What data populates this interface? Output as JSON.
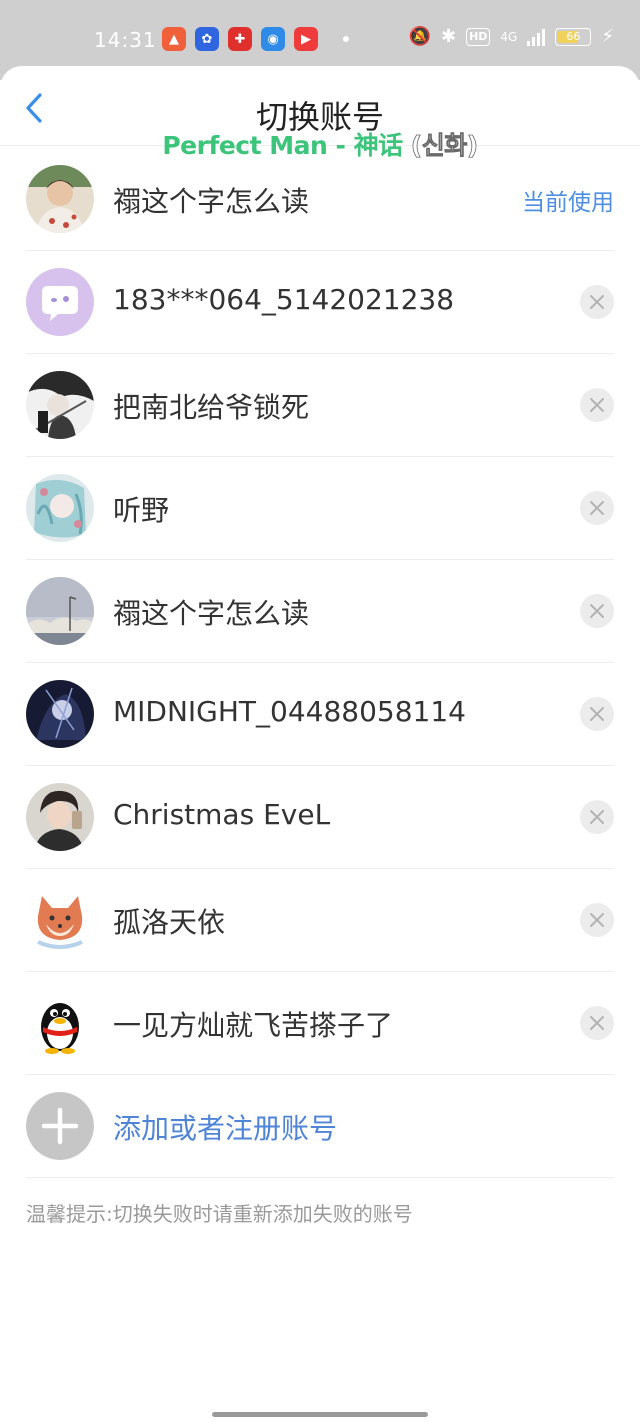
{
  "status_bar": {
    "time": "14:31",
    "apps": [
      {
        "name": "gallery-app-icon",
        "color": "#f0603a",
        "glyph": "▲"
      },
      {
        "name": "baidu-app-icon",
        "color": "#2f66e0",
        "glyph": "✿"
      },
      {
        "name": "red-app-icon",
        "color": "#e0302d",
        "glyph": "✚"
      },
      {
        "name": "browser-app-icon",
        "color": "#2f8ae8",
        "glyph": "◉"
      },
      {
        "name": "video-app-icon",
        "color": "#ef3b3b",
        "glyph": "▶"
      }
    ],
    "network_label": "4G",
    "hd_label": "HD",
    "battery": "66",
    "colors": {
      "background": "#cfcfcf",
      "battery_fill": "#f0d15a"
    }
  },
  "nav": {
    "title": "切换账号"
  },
  "lyric_overlay": {
    "text": "Perfect Man - 神话 ",
    "korean": "(신화)",
    "color": "#3bc47a"
  },
  "accounts": [
    {
      "name": "禤这个字怎么读",
      "current_label": "当前使用",
      "avatar": "person-portrait"
    },
    {
      "name": "183***064_5142021238",
      "avatar": "default-chat"
    },
    {
      "name": "把南北给爷锁死",
      "avatar": "anime-sketch"
    },
    {
      "name": "听野",
      "avatar": "anime-teal"
    },
    {
      "name": "禤这个字怎么读",
      "avatar": "sky-scenery"
    },
    {
      "name": "MIDNIGHT_04488058114",
      "avatar": "dark-anime"
    },
    {
      "name": "Christmas EveL",
      "avatar": "person-selfie"
    },
    {
      "name": "孤洛天依",
      "avatar": "shiba-dog"
    },
    {
      "name": "一见方灿就飞苦搽子了",
      "avatar": "qq-penguin"
    }
  ],
  "add_account": {
    "label": "添加或者注册账号"
  },
  "tip": "温馨提示:切换失败时请重新添加失败的账号",
  "colors": {
    "accent": "#4f8fe0",
    "divider": "#ededed",
    "remove_bg": "#ececec"
  }
}
